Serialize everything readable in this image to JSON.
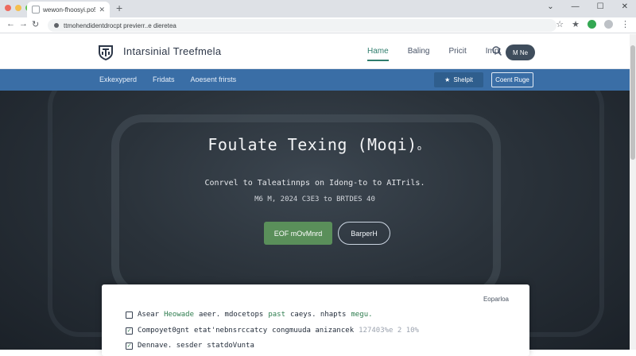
{
  "browser": {
    "tab_title": "wewon-fhoosyi.po5",
    "url": "ttmohendidentdrocpt previerr..e dieretea",
    "traffic_colors": [
      "#ed6a5e",
      "#f5bf4f",
      "#61c554"
    ],
    "ext_colors": [
      "#5f6368",
      "#34a853"
    ]
  },
  "header": {
    "brand": "Intarsinial Treefmela",
    "nav": [
      "Hame",
      "Baling",
      "Pricit",
      "Impt"
    ],
    "pill": "M Ne"
  },
  "subnav": {
    "links": [
      "Exkexyperd",
      "Fridats",
      "Aoesent frirsts"
    ],
    "shop_label": "Shelpit",
    "cta_label": "Coent Ruge"
  },
  "hero": {
    "title": "Foulate Texing (Moqi)",
    "title_suffix": "o",
    "subtitle": "Conrvel to Taleatinnps on Idong-to to AITrils.",
    "meta": "M6 M, 2024 C3E3 to BRTDES 40",
    "primary_btn": "EOF mOvMnrd",
    "secondary_btn": "BarperH"
  },
  "card": {
    "corner": "Eoparloa",
    "rows": [
      {
        "checked": false,
        "label": "Asear",
        "highlight": "Heowade",
        "rest": "aeer. mdocetops",
        "highlight2": "past",
        "rest2": "caeys. nhapts",
        "highlight3": "megu.",
        "muted": ""
      },
      {
        "checked": true,
        "label": "Compoyet0gnt",
        "highlight": "",
        "rest": "etat'nebnsrccatcy",
        "highlight2": "",
        "rest2": "congmuuda  anizancek",
        "highlight3": "",
        "muted": "127403%e  2  10%"
      },
      {
        "checked": true,
        "label": "Dennave. sesder",
        "highlight": "",
        "rest": "statdoVunta",
        "highlight2": "",
        "rest2": "",
        "highlight3": "",
        "muted": ""
      }
    ]
  }
}
